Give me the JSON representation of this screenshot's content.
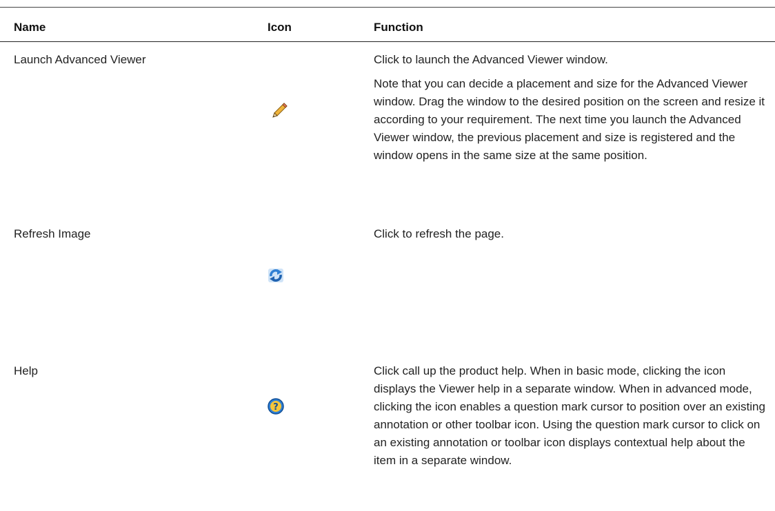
{
  "table": {
    "headers": {
      "name": "Name",
      "icon": "Icon",
      "function": "Function"
    },
    "rows": [
      {
        "name": "Launch Advanced Viewer",
        "icon": "pencil-icon",
        "function": [
          "Click to launch the Advanced Viewer window.",
          "Note that you can decide a placement and size for the Advanced Viewer window. Drag the window to the desired position on the screen and resize it according to your requirement. The next time you launch the Advanced Viewer window, the previous placement and size is registered and the window opens in the same size at the same position."
        ]
      },
      {
        "name": "Refresh Image",
        "icon": "refresh-icon",
        "function": [
          "Click to refresh the page."
        ]
      },
      {
        "name": "Help",
        "icon": "help-icon",
        "function": [
          "Click call up the product help. When in basic mode, clicking the icon displays the Viewer help in a separate window. When in advanced mode, clicking the icon enables a question mark cursor to position over an existing annotation or other toolbar icon. Using the question mark cursor to click on an existing annotation or toolbar icon displays contextual help about the item in a separate window."
        ]
      }
    ]
  },
  "colors": {
    "rule": "#222222",
    "text": "#222222",
    "icon_blue": "#2f7fd3"
  }
}
